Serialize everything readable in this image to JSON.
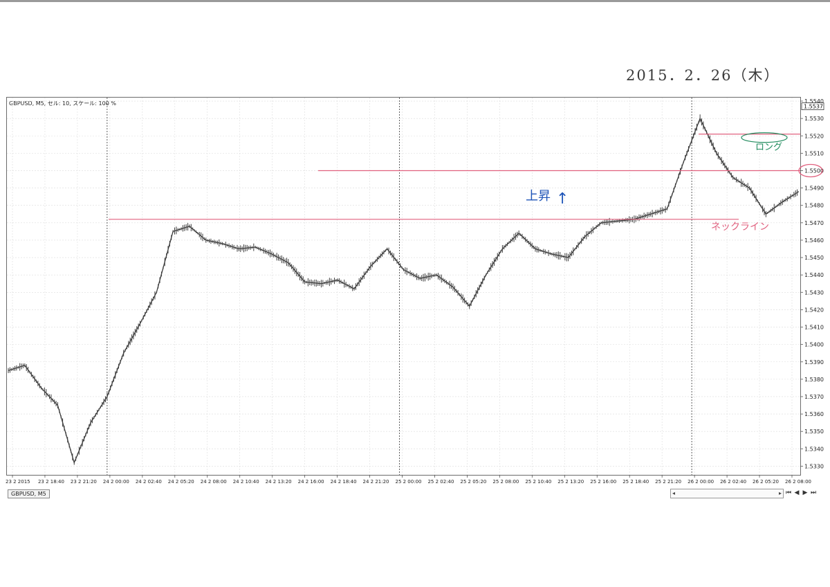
{
  "handwritten_date": "2015．2．26（木）",
  "header_text": "GBPUSD, M5, セル: 10, スケール: 100 %",
  "tab_label": "GBPUSD, M5",
  "colors": {
    "price": "#3c3c3c",
    "pink": "#e0607e",
    "blue": "#1f55b8",
    "green": "#1f8a5c",
    "grid": "#dcdcdc"
  },
  "chart_data": {
    "type": "line",
    "symbol": "GBPUSD",
    "timeframe": "M5",
    "y_ticks": [
      "1.5330",
      "1.5340",
      "1.5350",
      "1.5360",
      "1.5370",
      "1.5380",
      "1.5390",
      "1.5400",
      "1.5410",
      "1.5420",
      "1.5430",
      "1.5440",
      "1.5450",
      "1.5460",
      "1.5470",
      "1.5480",
      "1.5490",
      "1.5500",
      "1.5510",
      "1.5520",
      "1.5530",
      "1.5540"
    ],
    "ylim": [
      1.5325,
      1.5542
    ],
    "x_ticks": [
      "23 2 2015",
      "23 2 18:40",
      "23 2 21:20",
      "24 2 00:00",
      "24 2 02:40",
      "24 2 05:20",
      "24 2 08:00",
      "24 2 10:40",
      "24 2 13:20",
      "24 2 16:00",
      "24 2 18:40",
      "24 2 21:20",
      "25 2 00:00",
      "25 2 02:40",
      "25 2 05:20",
      "25 2 08:00",
      "25 2 10:40",
      "25 2 13:20",
      "25 2 16:00",
      "25 2 18:40",
      "25 2 21:20",
      "26 2 00:00",
      "26 2 02:40",
      "26 2 05:20",
      "26 2 08:00"
    ],
    "current_price": "1.5537",
    "series": [
      {
        "x": [
          0,
          0.5,
          1,
          1.5,
          2,
          2.5,
          3,
          3.5,
          4,
          4.5,
          5,
          5.5,
          6,
          6.5,
          7,
          7.5,
          8,
          8.5,
          9,
          9.5,
          10,
          10.5,
          11,
          11.5,
          12,
          12.5,
          13,
          13.5,
          14,
          14.5,
          15,
          15.5,
          16,
          16.5,
          17,
          17.5,
          18,
          18.5,
          19,
          19.5,
          20,
          20.5,
          21,
          21.5,
          22,
          22.5,
          23,
          23.5,
          24
        ],
        "values": [
          1.5385,
          1.5388,
          1.5375,
          1.5365,
          1.5332,
          1.5355,
          1.537,
          1.5395,
          1.5412,
          1.543,
          1.5465,
          1.5468,
          1.546,
          1.5458,
          1.5455,
          1.5456,
          1.5452,
          1.5447,
          1.5436,
          1.5435,
          1.5437,
          1.5432,
          1.5445,
          1.5455,
          1.5443,
          1.5438,
          1.544,
          1.5433,
          1.5422,
          1.544,
          1.5455,
          1.5464,
          1.5455,
          1.5452,
          1.545,
          1.5462,
          1.547,
          1.5471,
          1.5472,
          1.5475,
          1.5478,
          1.5505,
          1.553,
          1.551,
          1.5496,
          1.549,
          1.5475,
          1.5482,
          1.5488
        ]
      }
    ],
    "levels": [
      {
        "value": 1.5521,
        "color": "#e0607e"
      },
      {
        "value": 1.55,
        "color": "#e0607e"
      },
      {
        "value": 1.5472,
        "color": "#e0607e"
      }
    ]
  },
  "annotations": {
    "neckline": "ネックライン",
    "long": "ロング",
    "rise": "上昇",
    "rise_arrow": "↑",
    "circled_level": "1.5500"
  }
}
